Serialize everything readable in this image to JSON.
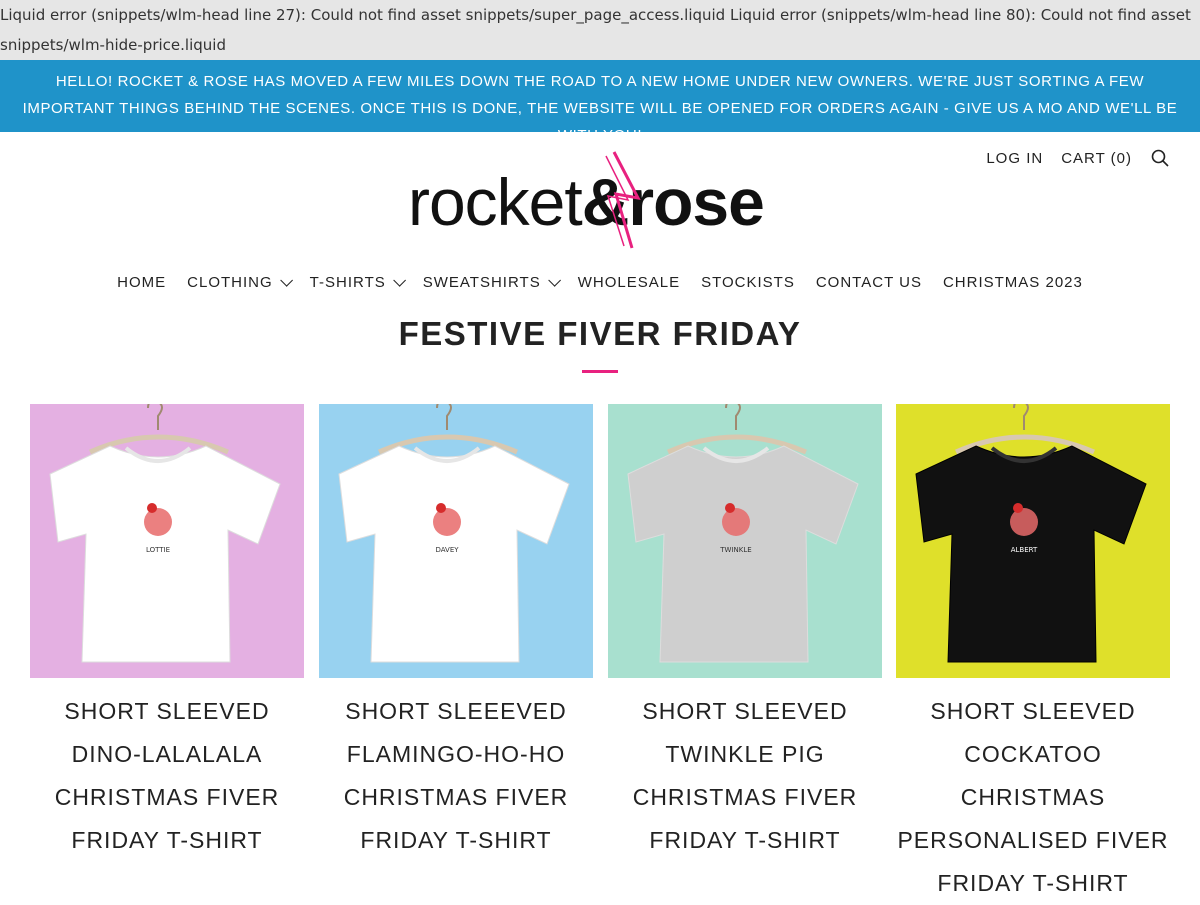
{
  "errors": {
    "text": "Liquid error (snippets/wlm-head line 27): Could not find asset snippets/super_page_access.liquid Liquid error (snippets/wlm-head line 80): Could not find asset snippets/wlm-hide-price.liquid"
  },
  "announcement": {
    "text": "Hello! Rocket & Rose has moved a few miles down the road to a new home under new owners. We're just sorting a few important things behind the scenes. Once this is done, the website will be opened for orders again - give us a mo and we'll be with you!"
  },
  "logo": {
    "part1": "rocket",
    "part2": "&rose",
    "accent": "#e8217f"
  },
  "header": {
    "login": "Log in",
    "cart": "Cart (0)",
    "search_icon": "search-icon"
  },
  "nav": {
    "items": [
      {
        "label": "Home",
        "dropdown": false
      },
      {
        "label": "Clothing",
        "dropdown": true
      },
      {
        "label": "T-Shirts",
        "dropdown": true
      },
      {
        "label": "Sweatshirts",
        "dropdown": true
      },
      {
        "label": "Wholesale",
        "dropdown": false
      },
      {
        "label": "Stockists",
        "dropdown": false
      },
      {
        "label": "Contact Us",
        "dropdown": false
      },
      {
        "label": "Christmas 2023",
        "dropdown": false
      }
    ]
  },
  "page": {
    "title": "Festive Fiver Friday"
  },
  "products": [
    {
      "name": "Short Sleeved Dino-Lalalala Christmas Fiver Friday T-Shirt",
      "bg": "#e4b0e2",
      "shirt": "#ffffff",
      "print_label": "LOTTIE"
    },
    {
      "name": "Short Sleeeved Flamingo-Ho-Ho Christmas Fiver Friday T-Shirt",
      "bg": "#98d2f0",
      "shirt": "#ffffff",
      "print_label": "DAVEY"
    },
    {
      "name": "Short Sleeved Twinkle Pig Christmas Fiver Friday T-Shirt",
      "bg": "#a8e0cf",
      "shirt": "#cfcfcf",
      "print_label": "TWINKLE"
    },
    {
      "name": "Short Sleeved Cockatoo Christmas Personalised Fiver Friday T-Shirt",
      "bg": "#dfe02a",
      "shirt": "#111111",
      "print_label": "ALBERT"
    }
  ]
}
